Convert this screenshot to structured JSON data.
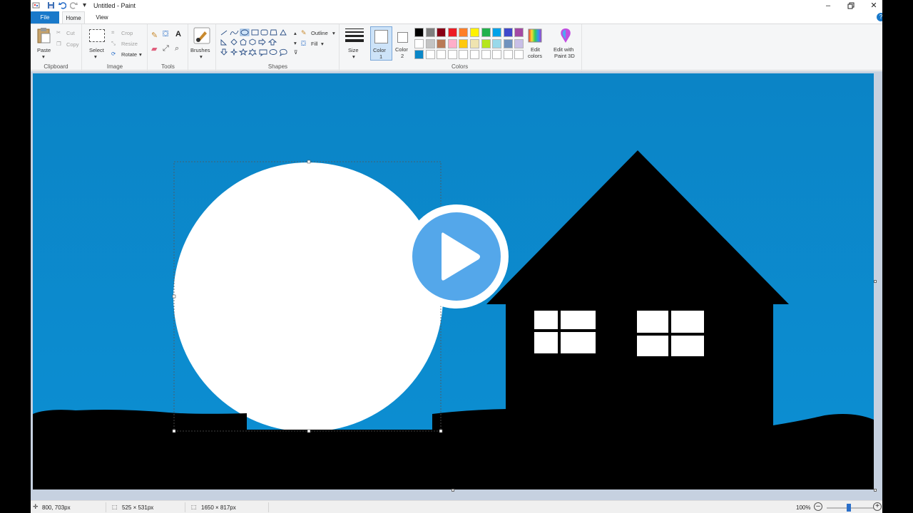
{
  "window": {
    "title": "Untitled - Paint"
  },
  "tabs": {
    "file": "File",
    "home": "Home",
    "view": "View"
  },
  "ribbon": {
    "clipboard": {
      "label": "Clipboard",
      "paste": "Paste",
      "cut": "Cut",
      "copy": "Copy"
    },
    "image": {
      "label": "Image",
      "select": "Select",
      "crop": "Crop",
      "resize": "Resize",
      "rotate": "Rotate"
    },
    "tools": {
      "label": "Tools"
    },
    "brushes": {
      "label": "Brushes"
    },
    "shapes": {
      "label": "Shapes",
      "outline": "Outline",
      "fill": "Fill"
    },
    "size": {
      "label": "Size"
    },
    "color1": {
      "line1": "Color",
      "line2": "1"
    },
    "color2": {
      "line1": "Color",
      "line2": "2"
    },
    "colors": {
      "label": "Colors",
      "row1": [
        "#000000",
        "#7f7f7f",
        "#880015",
        "#ed1c24",
        "#ff7f27",
        "#fff200",
        "#22b14c",
        "#00a2e8",
        "#3f48cc",
        "#a349a4"
      ],
      "row2": [
        "#ffffff",
        "#c3c3c3",
        "#b97a57",
        "#ffaec9",
        "#ffc90e",
        "#efe4b0",
        "#b5e61d",
        "#99d9ea",
        "#7092be",
        "#c8bfe7"
      ],
      "row3": [
        "#0a87c8",
        "#ffffff",
        "#ffffff",
        "#ffffff",
        "#ffffff",
        "#ffffff",
        "#ffffff",
        "#ffffff",
        "#ffffff",
        "#ffffff"
      ]
    },
    "edit_colors": {
      "line1": "Edit",
      "line2": "colors"
    },
    "paint3d": {
      "line1": "Edit with",
      "line2": "Paint 3D"
    }
  },
  "canvas": {
    "sky_color": "#0a87c8",
    "ground_color": "#000000",
    "circle_color": "#ffffff"
  },
  "statusbar": {
    "cursor": "800, 703px",
    "selection": "525 × 531px",
    "canvas_size": "1650 × 817px",
    "zoom": "100%"
  },
  "icons": {
    "save": "save-icon",
    "undo": "undo-icon",
    "redo": "redo-icon",
    "minimize": "minimize-icon",
    "restore": "restore-icon",
    "close": "close-icon",
    "play": "play-icon"
  }
}
